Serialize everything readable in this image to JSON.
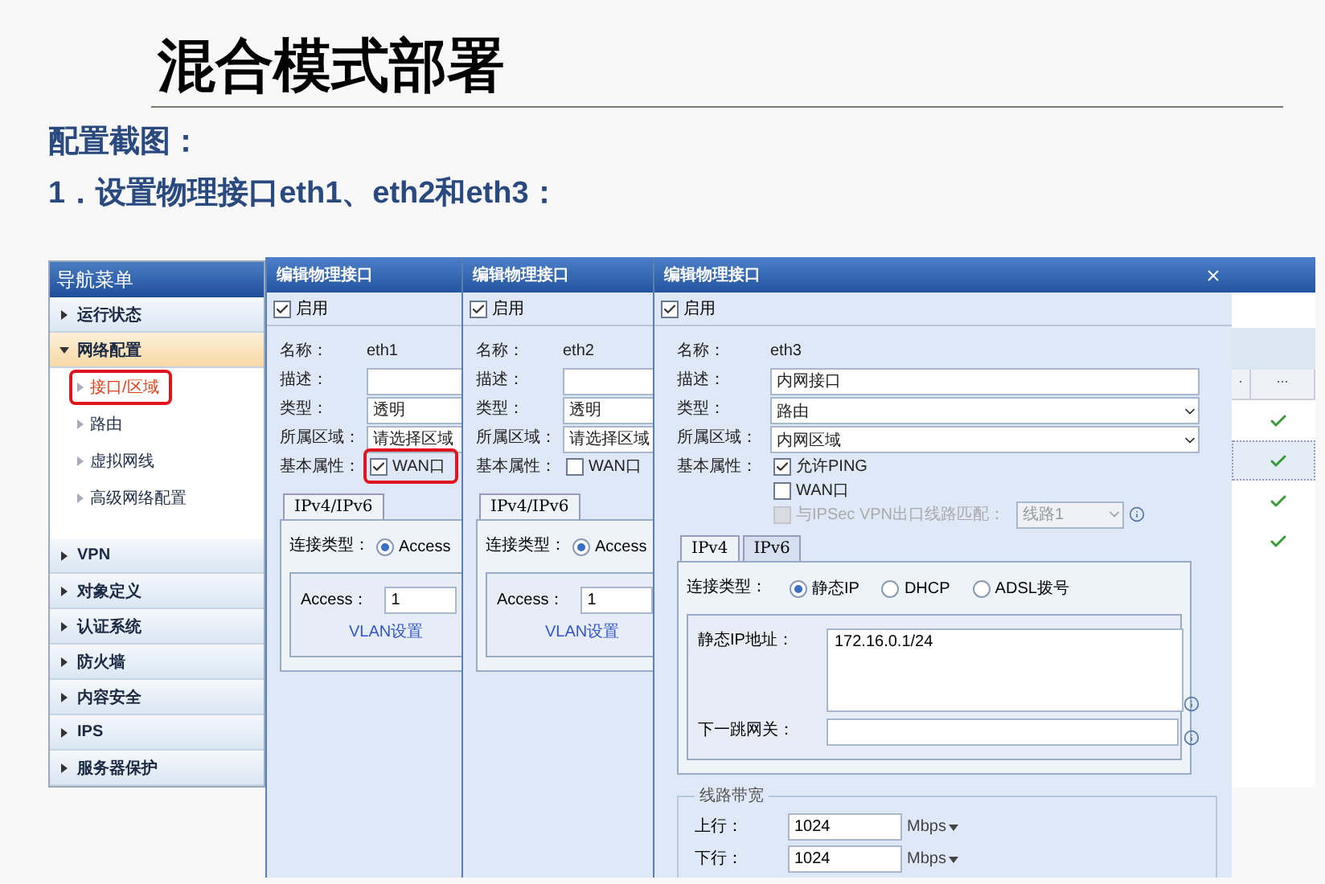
{
  "slide": {
    "title": "混合模式部署",
    "subtitle": "配置截图：",
    "step": "1．设置物理接口eth1、eth2和eth3："
  },
  "nav_menu": {
    "title": "导航菜单",
    "items": [
      {
        "label": "运行状态",
        "expanded": false
      },
      {
        "label": "网络配置",
        "expanded": true,
        "children": [
          {
            "label": "接口/区域",
            "selected": true,
            "highlighted": true
          },
          {
            "label": "路由",
            "selected": false,
            "highlighted": false
          },
          {
            "label": "虚拟网线",
            "selected": false,
            "highlighted": false
          },
          {
            "label": "高级网络配置",
            "selected": false,
            "highlighted": false
          }
        ]
      },
      {
        "label": "VPN",
        "expanded": false
      },
      {
        "label": "对象定义",
        "expanded": false
      },
      {
        "label": "认证系统",
        "expanded": false
      },
      {
        "label": "防火墙",
        "expanded": false
      },
      {
        "label": "内容安全",
        "expanded": false
      },
      {
        "label": "IPS",
        "expanded": false
      },
      {
        "label": "服务器保护",
        "expanded": false
      }
    ]
  },
  "background_table": {
    "columns": [
      ".",
      "..."
    ],
    "rows": [
      {
        "ok": true,
        "selected": false
      },
      {
        "ok": true,
        "selected": true
      },
      {
        "ok": true,
        "selected": false
      },
      {
        "ok": true,
        "selected": false
      }
    ]
  },
  "dialogs": [
    {
      "kind": "narrow",
      "title": "编辑物理接口",
      "enable_label": "启用",
      "enabled": true,
      "rows": [
        {
          "kind": "text",
          "label": "名称：",
          "value": "eth1"
        },
        {
          "kind": "input",
          "label": "描述："
        },
        {
          "kind": "input",
          "label": "类型：",
          "value": "透明"
        },
        {
          "kind": "input",
          "label": "所属区域：",
          "value": "请选择区域"
        },
        {
          "kind": "checks",
          "label": "基本属性：",
          "checks": [
            {
              "label": "WAN口",
              "checked": true,
              "highlighted": true,
              "disabled": false
            }
          ]
        }
      ],
      "tabs": [
        {
          "label": "IPv4/IPv6",
          "selected": true
        }
      ],
      "connection": {
        "label": "连接类型：",
        "options": [
          {
            "label": "Access",
            "selected": true
          }
        ]
      },
      "access": {
        "label": "Access：",
        "value": "1",
        "link": "VLAN设置"
      }
    },
    {
      "kind": "narrow",
      "title": "编辑物理接口",
      "enable_label": "启用",
      "enabled": true,
      "rows": [
        {
          "kind": "text",
          "label": "名称：",
          "value": "eth2"
        },
        {
          "kind": "input",
          "label": "描述："
        },
        {
          "kind": "input",
          "label": "类型：",
          "value": "透明"
        },
        {
          "kind": "input",
          "label": "所属区域：",
          "value": "请选择区域"
        },
        {
          "kind": "checks",
          "label": "基本属性：",
          "checks": [
            {
              "label": "WAN口",
              "checked": false,
              "highlighted": false,
              "disabled": false
            }
          ]
        }
      ],
      "tabs": [
        {
          "label": "IPv4/IPv6",
          "selected": true
        }
      ],
      "connection": {
        "label": "连接类型：",
        "options": [
          {
            "label": "Access",
            "selected": true
          }
        ]
      },
      "access": {
        "label": "Access：",
        "value": "1",
        "link": "VLAN设置"
      }
    },
    {
      "kind": "wide",
      "title": "编辑物理接口",
      "closable": true,
      "enable_label": "启用",
      "enabled": true,
      "rows": [
        {
          "kind": "text",
          "label": "名称：",
          "value": "eth3"
        },
        {
          "kind": "input",
          "label": "描述：",
          "value": "内网接口"
        },
        {
          "kind": "select",
          "label": "类型：",
          "value": "路由"
        },
        {
          "kind": "select",
          "label": "所属区域：",
          "value": "内网区域"
        },
        {
          "kind": "checks",
          "label": "基本属性：",
          "checks": [
            {
              "label": "允许PING",
              "checked": true,
              "highlighted": false,
              "disabled": false
            },
            {
              "label": "WAN口",
              "checked": false,
              "highlighted": false,
              "disabled": false
            },
            {
              "label": "与IPSec VPN出口线路匹配：",
              "checked": false,
              "highlighted": false,
              "disabled": true,
              "select": "线路1"
            }
          ]
        }
      ],
      "tabs": [
        {
          "label": "IPv4",
          "selected": true
        },
        {
          "label": "IPv6",
          "selected": false
        }
      ],
      "connection": {
        "label": "连接类型：",
        "options": [
          {
            "label": "静态IP",
            "selected": true
          },
          {
            "label": "DHCP",
            "selected": false
          },
          {
            "label": "ADSL拨号",
            "selected": false
          }
        ]
      },
      "static": [
        {
          "kind": "textarea",
          "label": "静态IP地址：",
          "value": "172.16.0.1/24"
        },
        {
          "kind": "input",
          "label": "下一跳网关："
        }
      ],
      "bandwidth": {
        "legend": "线路带宽",
        "rows": [
          {
            "label": "上行：",
            "value": "1024",
            "unit": "Mbps"
          },
          {
            "label": "下行：",
            "value": "1024",
            "unit": "Mbps"
          }
        ]
      }
    }
  ]
}
